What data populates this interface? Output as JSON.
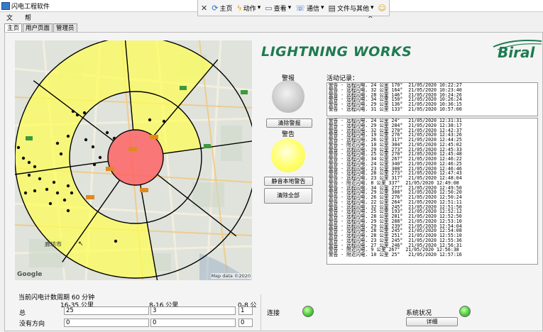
{
  "window": {
    "title": "闪电工程软件"
  },
  "remote_toolbar": {
    "items": [
      "主页",
      "动作",
      "查看",
      "通信",
      "文件与其他"
    ]
  },
  "menu": {
    "file": "文件",
    "help": "帮助"
  },
  "tabs": [
    "主页",
    "用户页面",
    "管理员"
  ],
  "brand": {
    "name": "LIGHTNING WORKS",
    "partner": "Biral"
  },
  "map": {
    "attribution": "Map data ©2020",
    "google": "Google",
    "city": "廊坊市"
  },
  "alarm": {
    "alarm_label": "警报",
    "clear_alarm": "清除警报",
    "warning_label": "警告",
    "mute_local": "静音本地警告",
    "clear_all": "清除全部",
    "alarm_color": "#c8c8c8",
    "warning_color": "#ffff66"
  },
  "activity": {
    "title": "活动记录：",
    "list1": [
      "警告 - 远程闪电. 24 公里 170°  21/05/2020 10:22:27",
      "警告 - 远程闪电. 32 公里 164°  21/05/2020 10:23:40",
      "警告 - 远程闪电. 28 公里 146°  21/05/2020 10:24:26",
      "警告 - 远程闪电. 34 公里 150°  21/05/2020 10:26:24",
      "警告 - 远程闪电. 29 公里 136°  21/05/2020 10:36:15",
      "警告 - 远程闪电. 31 公里 133°  21/05/2020 10:57:00"
    ],
    "list2": [
      "警告 - 远程闪电. 24 公里 24°   21/05/2020 12:31:31",
      "警告 - 远程闪电. 29 公里 284°  21/05/2020 12:38:17",
      "警告 - 远程闪电. 32 公里 270°  21/05/2020 12:42:37",
      "警告 - 远程闪电. 19 公里 276°  21/05/2020 12:43:26",
      "警告 - 远程闪电. 26 公里 317°  21/05/2020 12:44:25",
      "警告 - 附近闪电. 10 公里 304°  21/05/2020 12:45:02",
      "警告 - 远程闪电. 29 公里 273°  21/05/2020 12:45:33",
      "警告 - 远程闪电. 25 公里 270°  21/05/2020 12:45:48",
      "警告 - 远程闪电. 34 公里 267°  21/05/2020 12:46:22",
      "警告 - 远程闪电. 24 公里 340°  21/05/2020 12:46:25",
      "警告 - 远程闪电. 23 公里 308°  21/05/2020 12:46:46",
      "警告 - 远程闪电. 28 公里 273°  21/05/2020 12:47:43",
      "警告 - 远程闪电. 23 公里 317°  21/05/2020 12:48:04",
      "警告 - 附近闪电. 8 公里 337°  21/05/2020 12:49:08",
      "警告 - 远程闪电. 34 公里 277°  21/05/2020 12:49:50",
      "警告 - 远程闪电. 29 公里 308°  21/05/2020 12:50:20",
      "警告 - 远程闪电. 26 公里 276°  21/05/2020 12:50:24",
      "警告 - 远程闪电. 22 公里 264°  21/05/2020 12:51:11",
      "警告 - 远程闪电. 32 公里 245°  21/05/2020 12:51:50",
      "警告 - 远程闪电. 25 公里 193°  21/05/2020 12:52:12",
      "警告 - 远程闪电. 28 公里 281°  21/05/2020 12:52:50",
      "警告 - 远程闪电. 29 公里 288°  21/05/2020 12:53:10",
      "警告 - 远程闪电. 29 公里 239°  21/05/2020 12:54:04",
      "警告 - 远程闪电. 28 公里 245°  21/05/2020 12:54:08",
      "警告 - 远程闪电. 28 公里 251°  21/05/2020 12:55:10",
      "警告 - 远程闪电. 23 公里 245°  21/05/2020 12:55:36",
      "警告 - 远程闪电. 27 公里 246°  21/05/2020 12:56:31",
      "警告 - 附近闪电. 9 公里 267°  21/05/2020 12:56:38",
      "警告 - 附近闪电. 10 公里 25°   21/05/2020 12:57:16"
    ]
  },
  "stats": {
    "heading": "当前闪电计数周期 60 分钟",
    "col_far": "16-35 公里",
    "col_mid": "8-16 公里",
    "col_near": "0-8 公",
    "row_total": "总",
    "row_nodir": "没有方向",
    "total_far": "25",
    "total_mid": "3",
    "total_near": "1",
    "nodir_far": "0",
    "nodir_mid": "0",
    "nodir_near": "0"
  },
  "status": {
    "connect_label": "连接",
    "system_label": "系统状况",
    "details_button": "详细",
    "connect_color": "#4fcf3a",
    "system_color": "#4fcf3a"
  }
}
